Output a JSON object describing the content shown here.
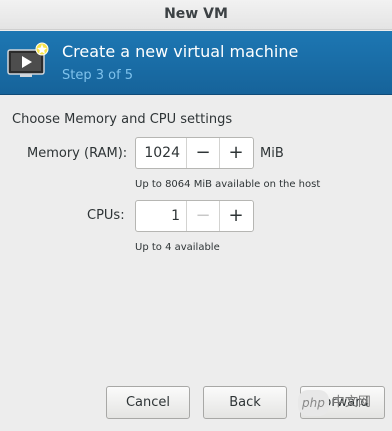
{
  "window": {
    "title": "New VM"
  },
  "header": {
    "icon": "vm-screen-play-icon",
    "title": "Create a new virtual machine",
    "step": "Step 3 of 5"
  },
  "section": {
    "label": "Choose Memory and CPU settings"
  },
  "memory": {
    "label": "Memory (RAM):",
    "value": "1024",
    "decrement": "−",
    "increment": "+",
    "unit": "MiB",
    "hint": "Up to 8064 MiB available on the host"
  },
  "cpus": {
    "label": "CPUs:",
    "value": "1",
    "decrement": "−",
    "increment": "+",
    "hint": "Up to 4 available"
  },
  "buttons": {
    "cancel": "Cancel",
    "back": "Back",
    "forward": "Forward"
  },
  "watermark": {
    "php": "php",
    "text": "中文网"
  },
  "colors": {
    "header_bg": "#1d77b3",
    "step_text": "#7fc2ec"
  }
}
